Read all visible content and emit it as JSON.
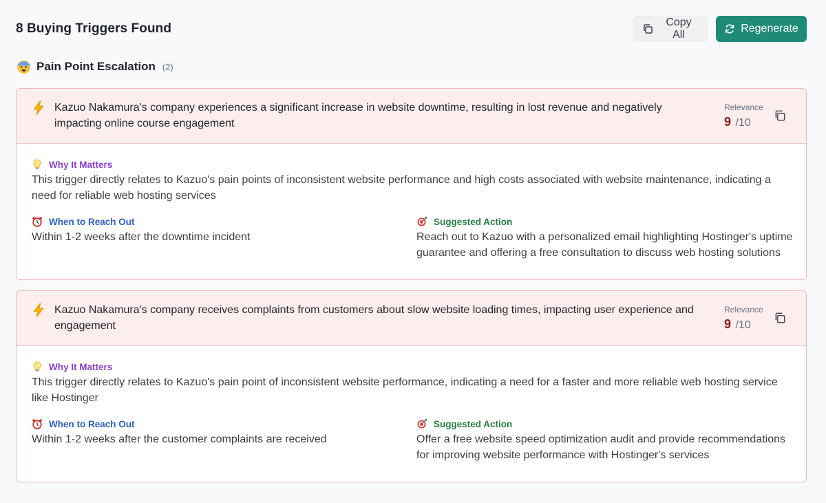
{
  "header": {
    "title": "8 Buying Triggers Found",
    "copy_all_label": "Copy All",
    "regenerate_label": "Regenerate"
  },
  "category": {
    "title": "Pain Point Escalation",
    "count": "(2)"
  },
  "labels": {
    "relevance": "Relevance",
    "why": "Why It Matters",
    "when": "When to Reach Out",
    "action": "Suggested Action",
    "score_suffix": "/10"
  },
  "triggers": [
    {
      "text": "Kazuo Nakamura's company experiences a significant increase in website downtime, resulting in lost revenue and negatively impacting online course engagement",
      "score": "9",
      "why": "This trigger directly relates to Kazuo's pain points of inconsistent website performance and high costs associated with website maintenance, indicating a need for reliable web hosting services",
      "when": "Within 1-2 weeks after the downtime incident",
      "action": "Reach out to Kazuo with a personalized email highlighting Hostinger's uptime guarantee and offering a free consultation to discuss web hosting solutions"
    },
    {
      "text": "Kazuo Nakamura's company receives complaints from customers about slow website loading times, impacting user experience and engagement",
      "score": "9",
      "why": "This trigger directly relates to Kazuo's pain point of inconsistent website performance, indicating a need for a faster and more reliable web hosting service like Hostinger",
      "when": "Within 1-2 weeks after the customer complaints are received",
      "action": "Offer a free website speed optimization audit and provide recommendations for improving website performance with Hostinger's services"
    }
  ],
  "colors": {
    "accent": "#1f8a78",
    "card_bg": "#fdeeee",
    "card_border": "#f2b8b8",
    "score": "#8a1c1c",
    "why": "#8a3fd1",
    "when": "#2b5fc7",
    "action": "#2a7d47"
  },
  "icons": {
    "copy_all": "copy-icon",
    "regenerate": "refresh-icon",
    "category": "anxious-face-icon",
    "trigger": "lightning-bolt-icon",
    "why": "light-bulb-icon",
    "when": "alarm-clock-icon",
    "action": "target-icon",
    "card_copy": "copy-icon"
  }
}
